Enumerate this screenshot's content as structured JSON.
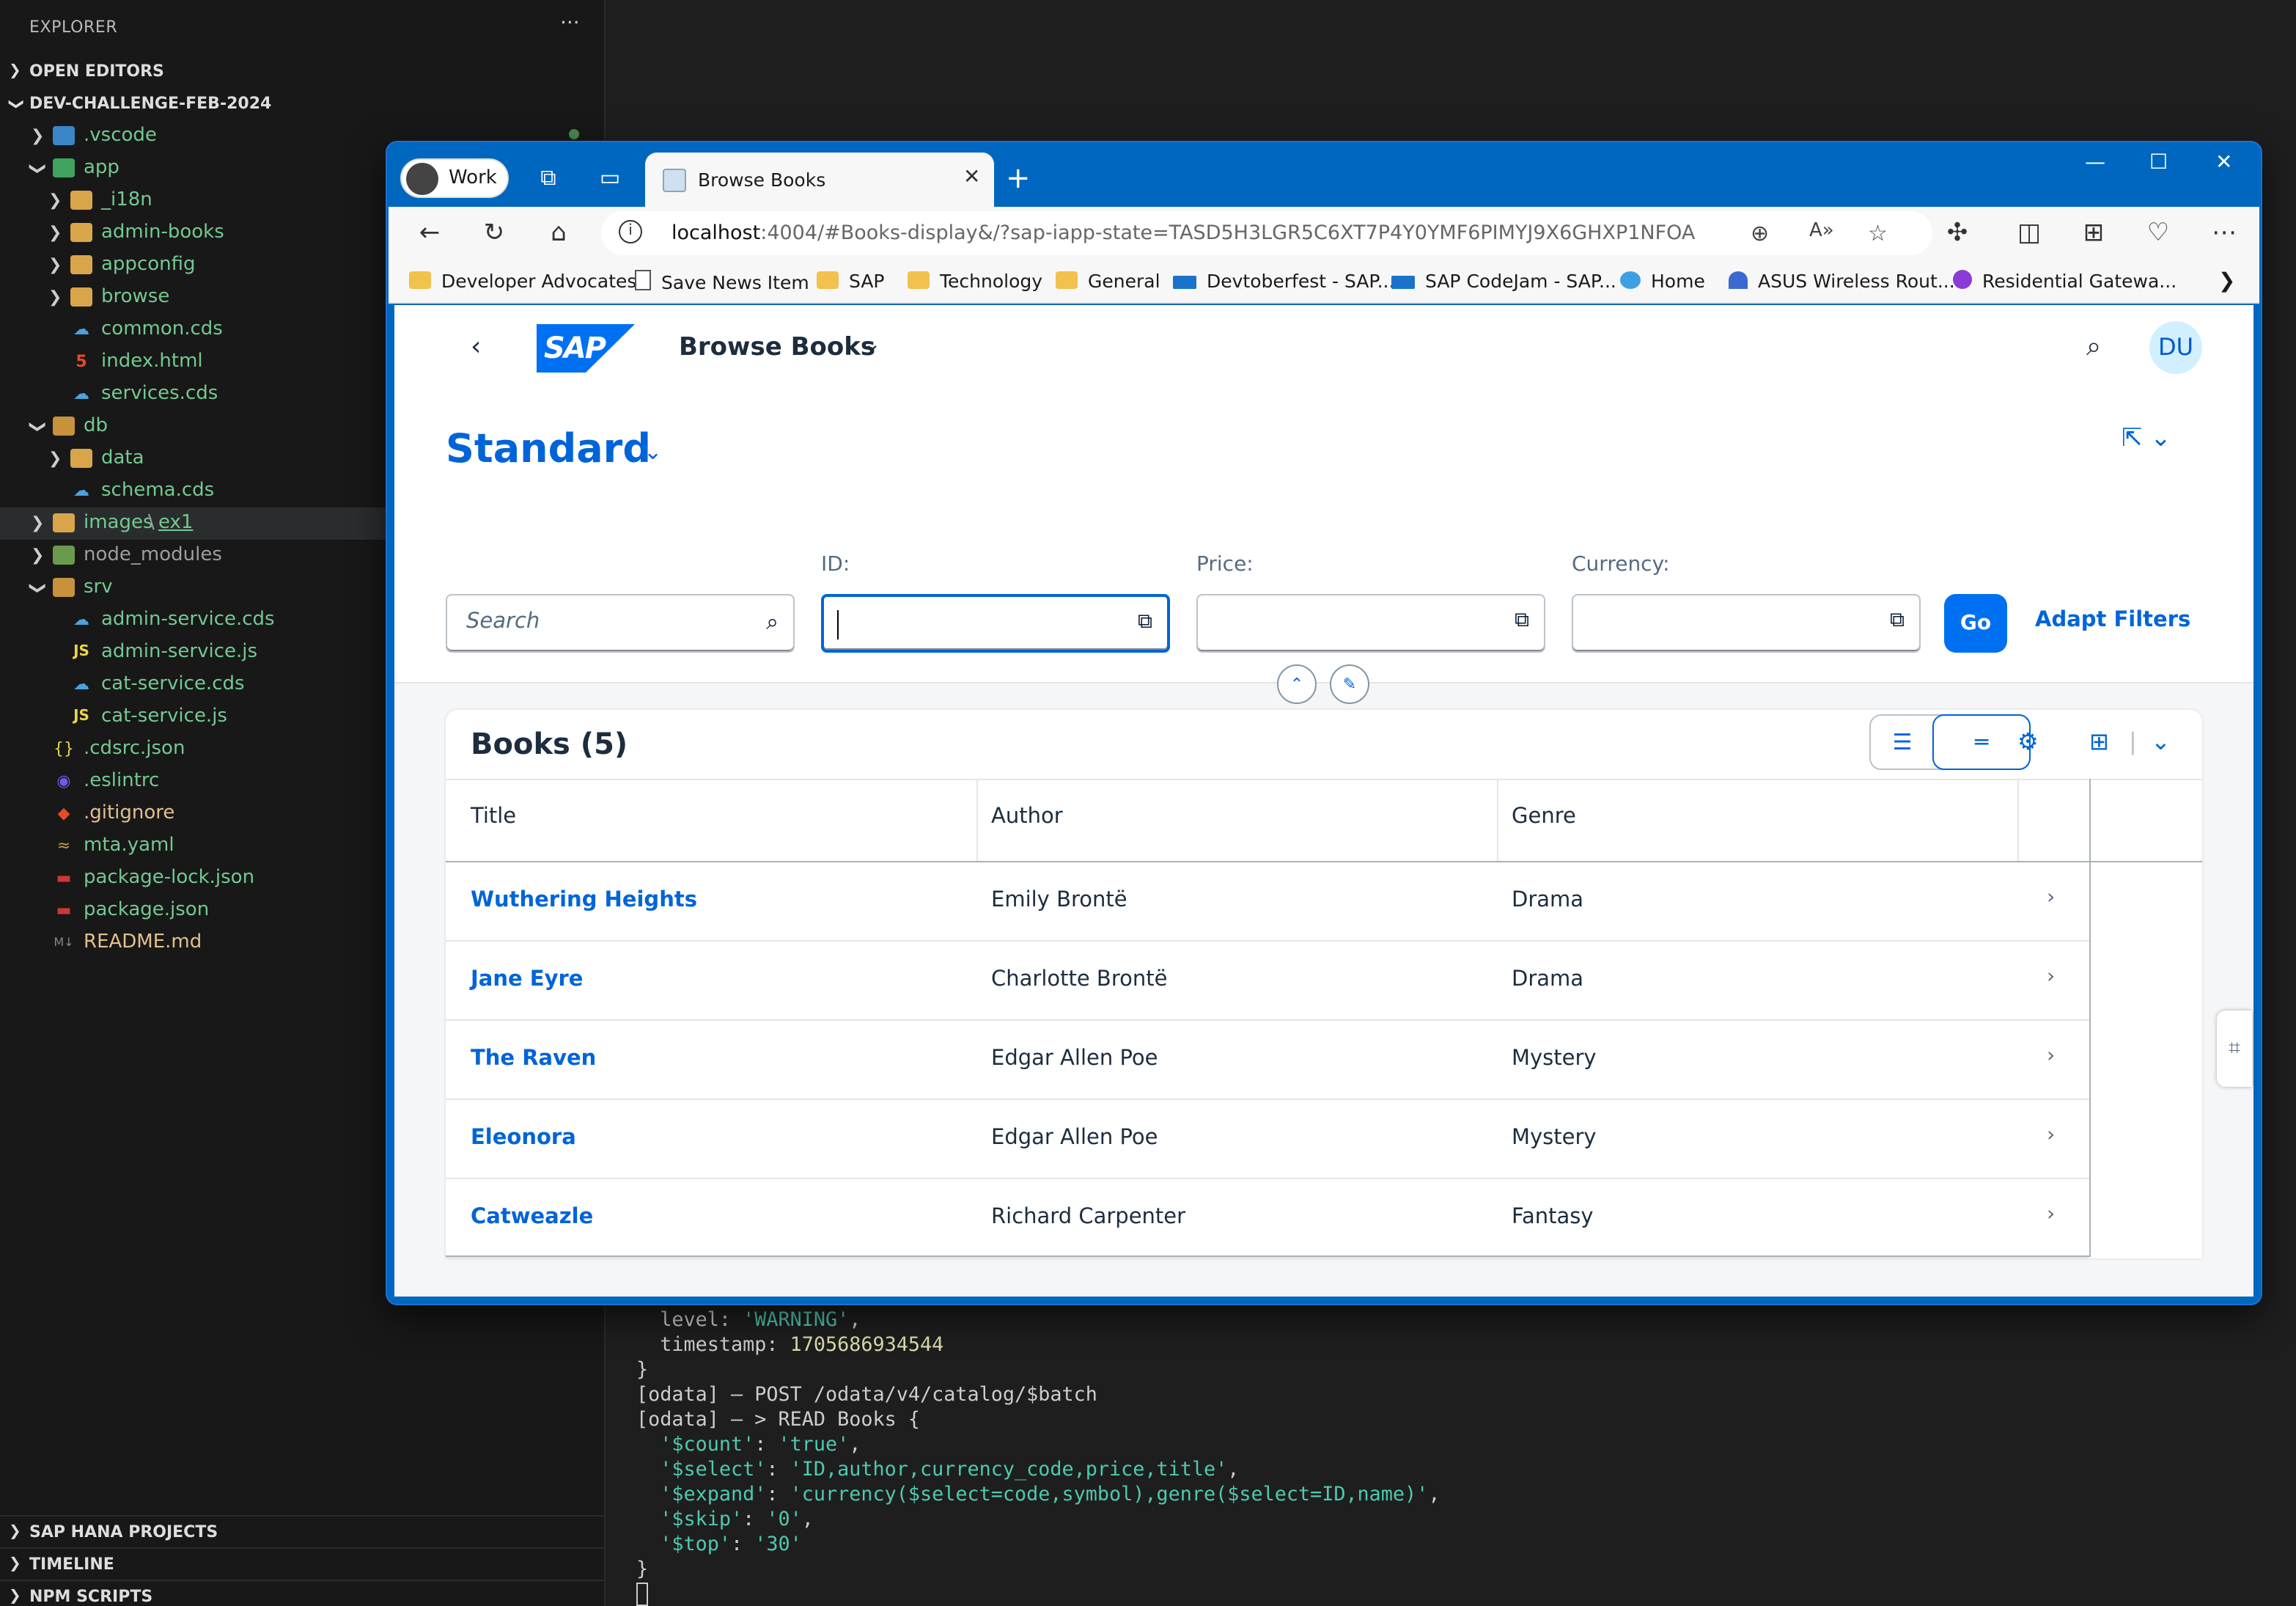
{
  "sidebar": {
    "title": "EXPLORER",
    "more": "···",
    "open_editors": "OPEN EDITORS",
    "project": "DEV-CHALLENGE-FEB-2024",
    "tree": [
      {
        "label": ".vscode"
      },
      {
        "label": "app"
      },
      {
        "label": "_i18n"
      },
      {
        "label": "admin-books"
      },
      {
        "label": "appconfig"
      },
      {
        "label": "browse"
      },
      {
        "label": "common.cds"
      },
      {
        "label": "index.html"
      },
      {
        "label": "services.cds"
      },
      {
        "label": "db"
      },
      {
        "label": "data"
      },
      {
        "label": "schema.cds"
      },
      {
        "label": "images",
        "suffix": "ex1"
      },
      {
        "label": "node_modules"
      },
      {
        "label": "srv"
      },
      {
        "label": "admin-service.cds"
      },
      {
        "label": "admin-service.js"
      },
      {
        "label": "cat-service.cds"
      },
      {
        "label": "cat-service.js"
      },
      {
        "label": ".cdsrc.json"
      },
      {
        "label": ".eslintrc"
      },
      {
        "label": ".gitignore"
      },
      {
        "label": "mta.yaml"
      },
      {
        "label": "package-lock.json"
      },
      {
        "label": "package.json"
      },
      {
        "label": "README.md"
      }
    ],
    "bottom_sections": [
      "SAP HANA PROJECTS",
      "TIMELINE",
      "NPM SCRIPTS"
    ]
  },
  "terminal": {
    "lines": [
      {
        "pre": "  level: ",
        "val": "'WARNING'",
        "post": ","
      },
      {
        "pre": "  timestamp: ",
        "num": "1705686934544"
      },
      {
        "pre": "}"
      },
      {
        "pre": "[odata] – POST /odata/v4/catalog/$batch"
      },
      {
        "pre": "[odata] – > READ Books {"
      },
      {
        "pre": "  ",
        "key": "'$count'",
        "mid": ": ",
        "val": "'true'",
        "post": ","
      },
      {
        "pre": "  ",
        "key": "'$select'",
        "mid": ": ",
        "val": "'ID,author,currency_code,price,title'",
        "post": ","
      },
      {
        "pre": "  ",
        "key": "'$expand'",
        "mid": ": ",
        "val": "'currency($select=code,symbol),genre($select=ID,name)'",
        "post": ","
      },
      {
        "pre": "  ",
        "key": "'$skip'",
        "mid": ": ",
        "val": "'0'",
        "post": ","
      },
      {
        "pre": "  ",
        "key": "'$top'",
        "mid": ": ",
        "val": "'30'"
      },
      {
        "pre": "}"
      }
    ]
  },
  "browser": {
    "profile": "Work",
    "tab_title": "Browse Books",
    "url_host": "localhost",
    "url_rest": ":4004/#Books-display&/?sap-iapp-state=TASD5H3LGR5C6XT7P4Y0YMF6PIMYJ9X6GHXP1NFOA",
    "bookmarks": [
      {
        "label": "Developer Advocates",
        "icon": "folder"
      },
      {
        "label": "Save News Item",
        "icon": "page"
      },
      {
        "label": "SAP",
        "icon": "folder"
      },
      {
        "label": "Technology",
        "icon": "folder"
      },
      {
        "label": "General",
        "icon": "folder"
      },
      {
        "label": "Devtoberfest - SAP...",
        "icon": "sap"
      },
      {
        "label": "SAP CodeJam - SAP...",
        "icon": "sap"
      },
      {
        "label": "Home",
        "icon": "home"
      },
      {
        "label": "ASUS Wireless Rout...",
        "icon": "wifi"
      },
      {
        "label": "Residential Gatewa...",
        "icon": "router"
      }
    ]
  },
  "app": {
    "logo": "SAP",
    "title": "Browse Books",
    "avatar": "DU",
    "variant": "Standard",
    "search_placeholder": "Search",
    "filters": [
      {
        "label": "ID:",
        "value": ""
      },
      {
        "label": "Price:",
        "value": ""
      },
      {
        "label": "Currency:",
        "value": ""
      }
    ],
    "go": "Go",
    "adapt_filters": "Adapt Filters",
    "table_title": "Books (5)",
    "columns": [
      "Title",
      "Author",
      "Genre"
    ],
    "rows": [
      {
        "title": "Wuthering Heights",
        "author": "Emily Brontë",
        "genre": "Drama"
      },
      {
        "title": "Jane Eyre",
        "author": "Charlotte Brontë",
        "genre": "Drama"
      },
      {
        "title": "The Raven",
        "author": "Edgar Allen Poe",
        "genre": "Mystery"
      },
      {
        "title": "Eleonora",
        "author": "Edgar Allen Poe",
        "genre": "Mystery"
      },
      {
        "title": "Catweazle",
        "author": "Richard Carpenter",
        "genre": "Fantasy"
      }
    ]
  },
  "colors": {
    "sap_blue": "#0064d9",
    "shell_bg": "#ffffff",
    "page_bg": "#f5f6f7",
    "browser_frame": "#0067c0",
    "vscode_bg": "#181818"
  }
}
